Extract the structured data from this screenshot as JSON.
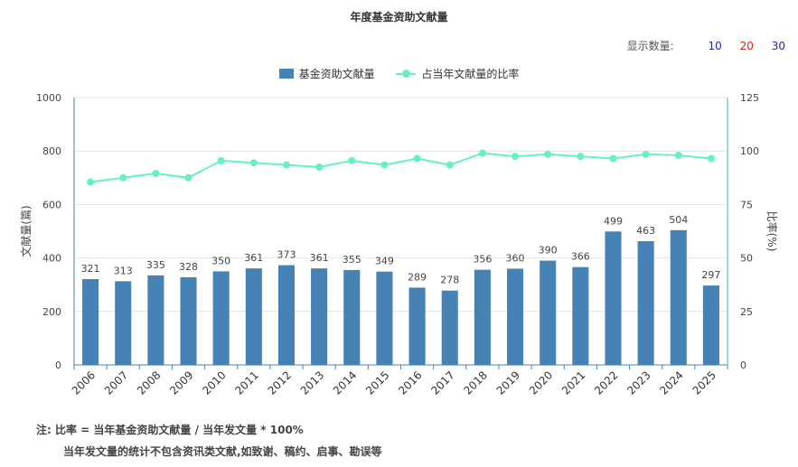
{
  "title": "年度基金资助文献量",
  "show_count": {
    "label": "显示数量:",
    "options": [
      "10",
      "20",
      "30"
    ],
    "colors": [
      "#2222cc",
      "#cc2222",
      "#2222aa"
    ]
  },
  "legend": [
    {
      "label": "基金资助文献量",
      "color": "#4682b4"
    },
    {
      "label": "占当年文献量的比率",
      "color": "#67f0c0"
    }
  ],
  "notes": {
    "line1": "注:  比率 = 当年基金资助文献量 / 当年发文量 * 100%",
    "line2": "当年发文量的统计不包含资讯类文献,如致谢、稿约、启事、勘误等"
  },
  "chart_data": {
    "type": "bar",
    "categories": [
      "2006",
      "2007",
      "2008",
      "2009",
      "2010",
      "2011",
      "2012",
      "2013",
      "2014",
      "2015",
      "2016",
      "2017",
      "2018",
      "2019",
      "2020",
      "2021",
      "2022",
      "2023",
      "2024",
      "2025"
    ],
    "series": [
      {
        "name": "基金资助文献量",
        "type": "bar",
        "axis": "left",
        "color": "#4682b4",
        "values": [
          321,
          313,
          335,
          328,
          350,
          361,
          373,
          361,
          355,
          349,
          289,
          278,
          356,
          360,
          390,
          366,
          499,
          463,
          504,
          297
        ]
      },
      {
        "name": "占当年文献量的比率",
        "type": "line",
        "axis": "right",
        "color": "#67f0c0",
        "values": [
          85.5,
          87.5,
          89.5,
          87.5,
          95.5,
          94.5,
          93.5,
          92.5,
          95.5,
          93.5,
          96.5,
          93.5,
          99,
          97.5,
          98.5,
          97.5,
          96.5,
          98.5,
          98,
          96.5
        ]
      }
    ],
    "ylabel": "文献量(篇)",
    "y2label": "比率(%)",
    "ylim": [
      0,
      1000
    ],
    "y2lim": [
      0,
      125
    ],
    "yticks": [
      0,
      200,
      400,
      600,
      800,
      1000
    ],
    "y2ticks": [
      0,
      25,
      50,
      75,
      100,
      125
    ],
    "grid": true,
    "legend_position": "top-center"
  }
}
